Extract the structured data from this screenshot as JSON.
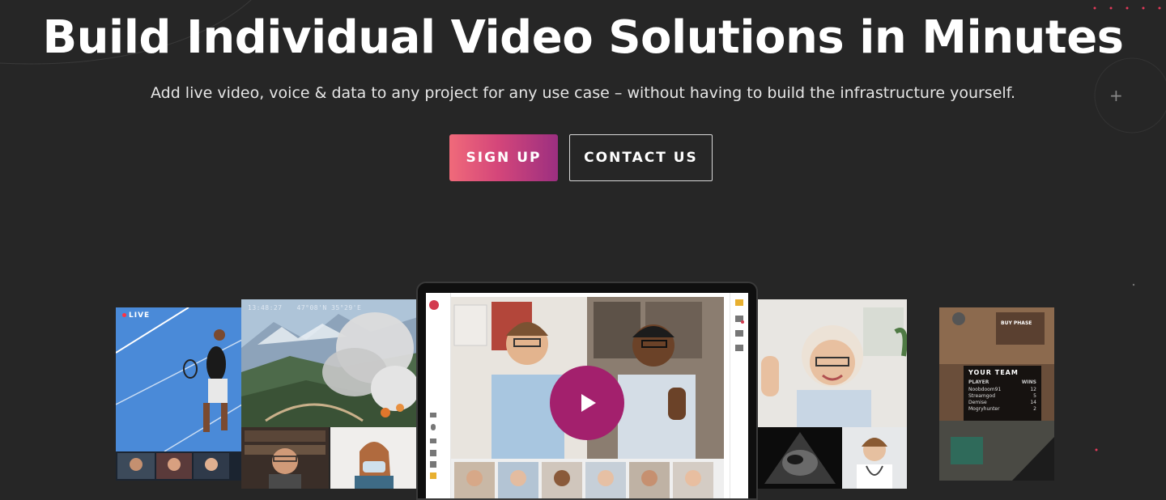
{
  "hero": {
    "title": "Build Individual Video Solutions in Minutes",
    "subtitle": "Add live video, voice & data to any project for any use case – without having to build the infrastructure yourself."
  },
  "cta": {
    "signup_label": "SIGN UP",
    "contact_label": "CONTACT US"
  },
  "tiles": {
    "sports_badge": "LIVE",
    "wildfire_time": "13:48:27",
    "wildfire_coords": "47°08'N 35°29'E"
  },
  "gaming": {
    "badge": "BUY PHASE",
    "title": "YOUR TEAM",
    "headers": [
      "PLAYER",
      "WINS"
    ],
    "players": [
      {
        "name": "Noobdoom91",
        "wins": "12"
      },
      {
        "name": "Streamgod",
        "wins": "5"
      },
      {
        "name": "Demise",
        "wins": "14"
      },
      {
        "name": "Mogryhunter",
        "wins": "2"
      }
    ]
  },
  "colors": {
    "background": "#262626",
    "signup_gradient_start": "#f06a7a",
    "signup_gradient_end": "#9c2f80",
    "play_button": "#a3206d",
    "accent_dot": "#e23a5a"
  }
}
